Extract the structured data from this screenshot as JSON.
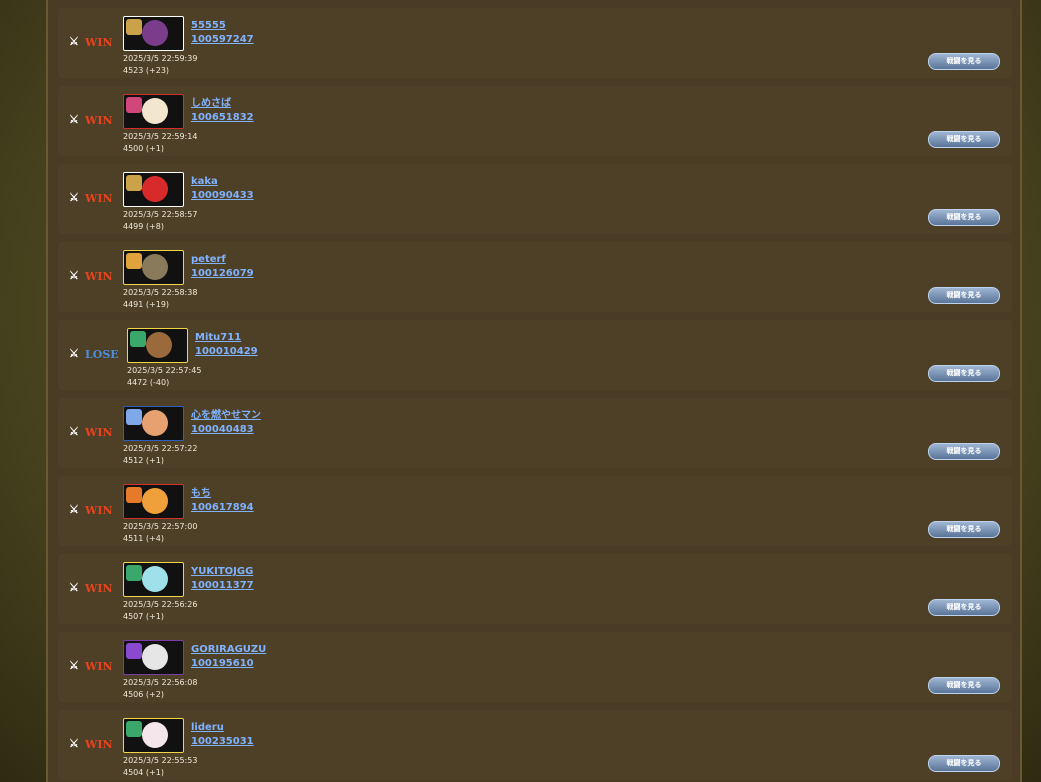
{
  "battle_log": {
    "view_button_label": "戦闘を見る",
    "entries": [
      {
        "result": "WIN",
        "name": "55555",
        "id": "100597247",
        "datetime": "2025/3/5 22:59:39",
        "score": "4523 (+23)",
        "frame_color": "#ffffff",
        "cut_color": "#c9a24a",
        "ball_color": "#7b3c8c"
      },
      {
        "result": "WIN",
        "name": "しめさば",
        "id": "100651832",
        "datetime": "2025/3/5 22:59:14",
        "score": "4500 (+1)",
        "frame_color": "#d4302a",
        "cut_color": "#d2477a",
        "ball_color": "#f2e6cf"
      },
      {
        "result": "WIN",
        "name": "kaka",
        "id": "100090433",
        "datetime": "2025/3/5 22:58:57",
        "score": "4499 (+8)",
        "frame_color": "#ffffff",
        "cut_color": "#c9a24a",
        "ball_color": "#d82a2a"
      },
      {
        "result": "WIN",
        "name": "peterf",
        "id": "100126079",
        "datetime": "2025/3/5 22:58:38",
        "score": "4491 (+19)",
        "frame_color": "#f2d643",
        "cut_color": "#e0a23a",
        "ball_color": "#8a7a5c"
      },
      {
        "result": "LOSE",
        "name": "Mitu711",
        "id": "100010429",
        "datetime": "2025/3/5 22:57:45",
        "score": "4472 (-40)",
        "frame_color": "#f2d643",
        "cut_color": "#3aa86a",
        "ball_color": "#9a6a3c"
      },
      {
        "result": "WIN",
        "name": "心を燃やせマン",
        "id": "100040483",
        "datetime": "2025/3/5 22:57:22",
        "score": "4512 (+1)",
        "frame_color": "#2d5fbf",
        "cut_color": "#7fa8e8",
        "ball_color": "#e7a070"
      },
      {
        "result": "WIN",
        "name": "もち",
        "id": "100617894",
        "datetime": "2025/3/5 22:57:00",
        "score": "4511 (+4)",
        "frame_color": "#d4302a",
        "cut_color": "#e57a2a",
        "ball_color": "#f0a03a"
      },
      {
        "result": "WIN",
        "name": "YUKITOJGG",
        "id": "100011377",
        "datetime": "2025/3/5 22:56:26",
        "score": "4507 (+1)",
        "frame_color": "#f2d643",
        "cut_color": "#3aa86a",
        "ball_color": "#9fe0ea"
      },
      {
        "result": "WIN",
        "name": "GORIRAGUZU",
        "id": "100195610",
        "datetime": "2025/3/5 22:56:08",
        "score": "4506 (+2)",
        "frame_color": "#7a3ca8",
        "cut_color": "#8a4ad0",
        "ball_color": "#e6e6e6"
      },
      {
        "result": "WIN",
        "name": "lideru",
        "id": "100235031",
        "datetime": "2025/3/5 22:55:53",
        "score": "4504 (+1)",
        "frame_color": "#f2d643",
        "cut_color": "#3aa86a",
        "ball_color": "#f4e6ea"
      }
    ]
  }
}
